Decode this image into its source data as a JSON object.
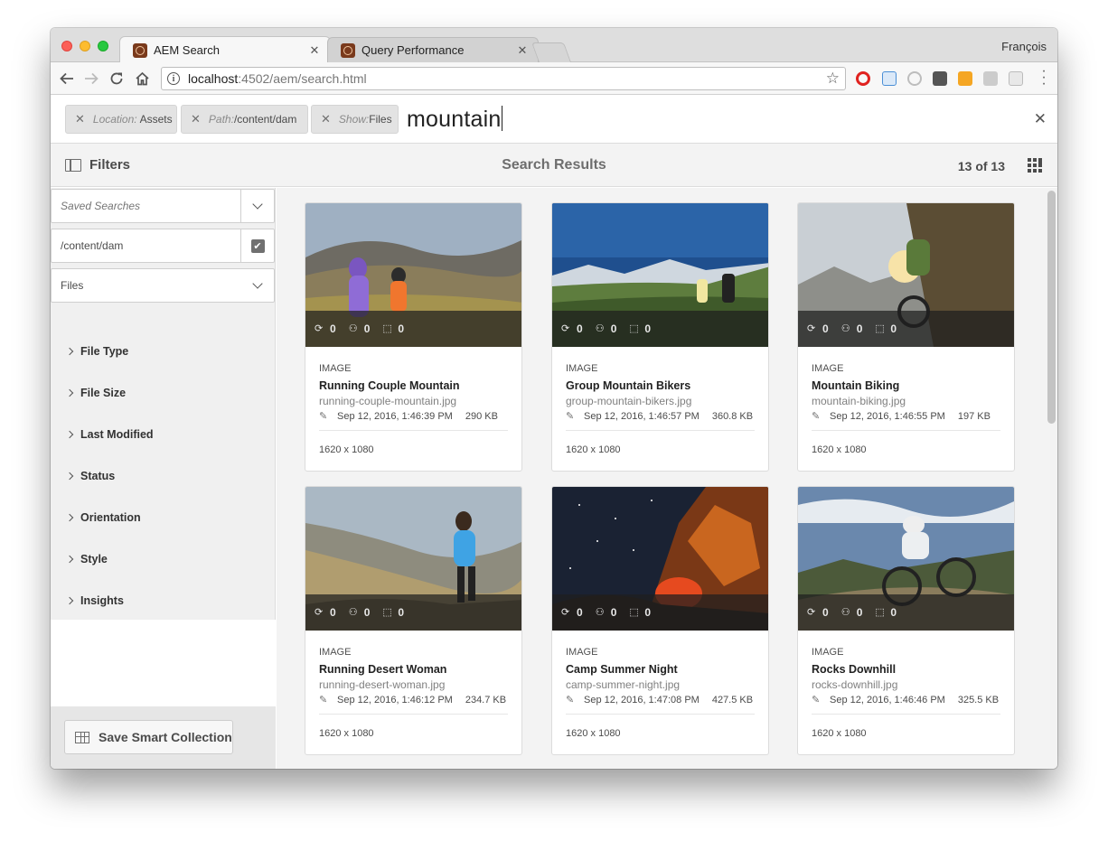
{
  "browser": {
    "profile_name": "François",
    "tabs": [
      {
        "label": "AEM Search",
        "close": "✕"
      },
      {
        "label": "Query Performance",
        "close": "✕"
      }
    ],
    "url_host": "localhost",
    "url_rest": ":4502/aem/search.html"
  },
  "search": {
    "chips": [
      {
        "key": "Location:",
        "value": "Assets"
      },
      {
        "key": "Path:",
        "value": "/content/dam"
      },
      {
        "key": "Show:",
        "value": "Files"
      }
    ],
    "query": "mountain"
  },
  "header": {
    "filters_label": "Filters",
    "title": "Search Results",
    "count": "13 of 13"
  },
  "filters": {
    "saved_searches_placeholder": "Saved Searches",
    "path_value": "/content/dam",
    "show_value": "Files",
    "groups": [
      "File Type",
      "File Size",
      "Last Modified",
      "Status",
      "Orientation",
      "Style",
      "Insights"
    ],
    "save_collection_label": "Save Smart Collection"
  },
  "cards": [
    {
      "type": "IMAGE",
      "title": "Running Couple Mountain",
      "file": "running-couple-mountain.jpg",
      "date": "Sep 12, 2016, 1:46:39 PM",
      "size": "290 KB",
      "dims": "1620 x 1080",
      "stats": [
        "0",
        "0",
        "0"
      ]
    },
    {
      "type": "IMAGE",
      "title": "Group Mountain Bikers",
      "file": "group-mountain-bikers.jpg",
      "date": "Sep 12, 2016, 1:46:57 PM",
      "size": "360.8 KB",
      "dims": "1620 x 1080",
      "stats": [
        "0",
        "0",
        "0"
      ]
    },
    {
      "type": "IMAGE",
      "title": "Mountain Biking",
      "file": "mountain-biking.jpg",
      "date": "Sep 12, 2016, 1:46:55 PM",
      "size": "197 KB",
      "dims": "1620 x 1080",
      "stats": [
        "0",
        "0",
        "0"
      ]
    },
    {
      "type": "IMAGE",
      "title": "Running Desert Woman",
      "file": "running-desert-woman.jpg",
      "date": "Sep 12, 2016, 1:46:12 PM",
      "size": "234.7 KB",
      "dims": "1620 x 1080",
      "stats": [
        "0",
        "0",
        "0"
      ]
    },
    {
      "type": "IMAGE",
      "title": "Camp Summer Night",
      "file": "camp-summer-night.jpg",
      "date": "Sep 12, 2016, 1:47:08 PM",
      "size": "427.5 KB",
      "dims": "1620 x 1080",
      "stats": [
        "0",
        "0",
        "0"
      ]
    },
    {
      "type": "IMAGE",
      "title": "Rocks Downhill",
      "file": "rocks-downhill.jpg",
      "date": "Sep 12, 2016, 1:46:46 PM",
      "size": "325.5 KB",
      "dims": "1620 x 1080",
      "stats": [
        "0",
        "0",
        "0"
      ]
    }
  ]
}
